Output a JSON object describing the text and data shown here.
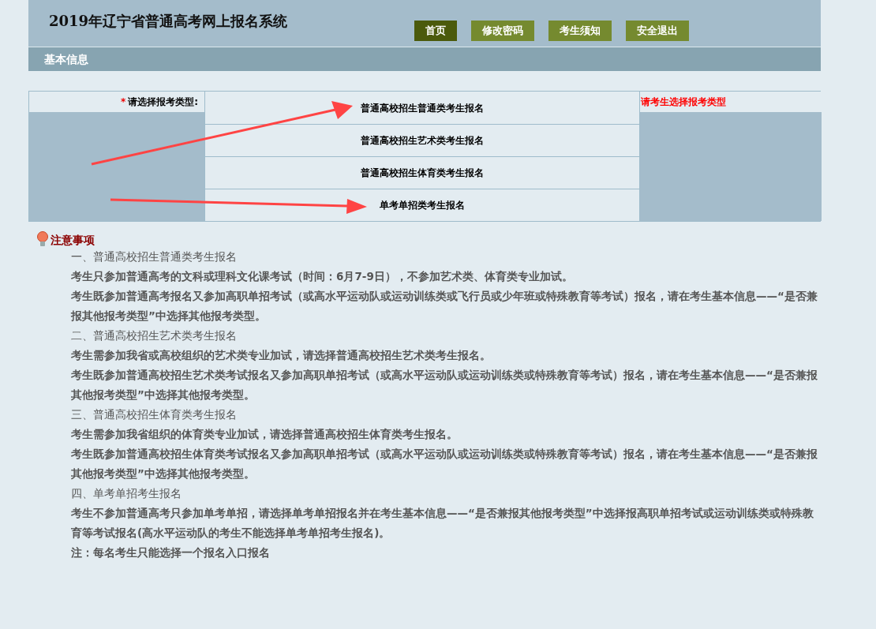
{
  "header": {
    "title": "2019年辽宁省普通高考网上报名系统",
    "nav": [
      {
        "label": "首页",
        "selected": true
      },
      {
        "label": "修改密码",
        "selected": false
      },
      {
        "label": "考生须知",
        "selected": false
      },
      {
        "label": "安全退出",
        "selected": false
      }
    ]
  },
  "section_bar": {
    "title": "基本信息"
  },
  "form": {
    "required_mark": "*",
    "label": "请选择报考类型:",
    "options": [
      "普通高校招生普通类考生报名",
      "普通高校招生艺术类考生报名",
      "普通高校招生体育类考生报名",
      "单考单招类考生报名"
    ],
    "message": "请考生选择报考类型"
  },
  "notes": {
    "title": "注意事项",
    "items": [
      {
        "kind": "heading",
        "text": "一、普通高校招生普通类考生报名"
      },
      {
        "kind": "paragraph",
        "text": "考生只参加普通高考的文科或理科文化课考试（时间：6月7-9日），不参加艺术类、体育类专业加试。"
      },
      {
        "kind": "paragraph",
        "text": "考生既参加普通高考报名又参加高职单招考试（或高水平运动队或运动训练类或飞行员或少年班或特殊教育等考试）报名，请在考生基本信息——“是否兼报其他报考类型”中选择其他报考类型。"
      },
      {
        "kind": "heading",
        "text": "二、普通高校招生艺术类考生报名"
      },
      {
        "kind": "paragraph",
        "text": "考生需参加我省或高校组织的艺术类专业加试，请选择普通高校招生艺术类考生报名。"
      },
      {
        "kind": "paragraph",
        "text": "考生既参加普通高校招生艺术类考试报名又参加高职单招考试（或高水平运动队或运动训练类或特殊教育等考试）报名，请在考生基本信息——“是否兼报其他报考类型”中选择其他报考类型。"
      },
      {
        "kind": "heading",
        "text": "三、普通高校招生体育类考生报名"
      },
      {
        "kind": "paragraph",
        "text": "考生需参加我省组织的体育类专业加试，请选择普通高校招生体育类考生报名。"
      },
      {
        "kind": "paragraph",
        "text": "考生既参加普通高校招生体育类考试报名又参加高职单招考试（或高水平运动队或运动训练类或特殊教育等考试）报名，请在考生基本信息——“是否兼报其他报考类型”中选择其他报考类型。"
      },
      {
        "kind": "heading",
        "text": "四、单考单招考生报名"
      },
      {
        "kind": "paragraph",
        "text": "考生不参加普通高考只参加单考单招，请选择单考单招报名并在考生基本信息——“是否兼报其他报考类型”中选择报高职单招考试或运动训练类或特殊教育等考试报名(高水平运动队的考生不能选择单考单招考生报名)。"
      },
      {
        "kind": "paragraph",
        "text": "注：每名考生只能选择一个报名入口报名"
      }
    ]
  }
}
